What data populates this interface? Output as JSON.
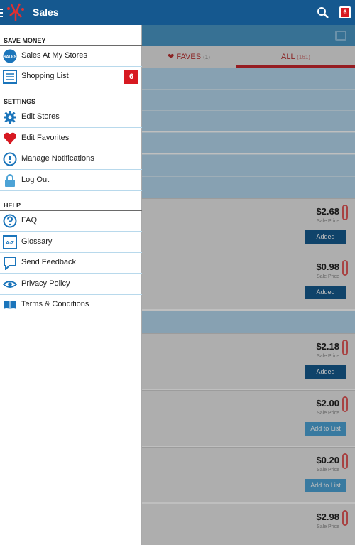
{
  "app": {
    "title": "Sales",
    "cart_count": "6"
  },
  "background": {
    "tabs": [
      {
        "label": "FAVES",
        "count": "(1)"
      },
      {
        "label": "ALL",
        "count": "(161)"
      }
    ],
    "deals": [
      {
        "price": "$2.68",
        "price_label": "Sale Price",
        "action": "Added"
      },
      {
        "price": "$0.98",
        "price_label": "Sale Price",
        "action": "Added"
      },
      {
        "price": "$2.18",
        "price_label": "Sale Price",
        "action": "Added"
      },
      {
        "price": "$2.00",
        "price_label": "Sale Price",
        "action": "Add to List"
      },
      {
        "price": "$0.20",
        "price_label": "Sale Price",
        "action": "Add to List"
      },
      {
        "price": "$2.98",
        "price_label": "Sale Price",
        "action": ""
      }
    ]
  },
  "drawer": {
    "save_money": {
      "header": "SAVE MONEY",
      "items": [
        {
          "label": "Sales At My Stores",
          "icon": "sales-icon",
          "icon_text": "SALES"
        },
        {
          "label": "Shopping List",
          "icon": "list-icon",
          "badge": "6"
        }
      ]
    },
    "settings": {
      "header": "SETTINGS",
      "items": [
        {
          "label": "Edit Stores",
          "icon": "gear-icon"
        },
        {
          "label": "Edit Favorites",
          "icon": "heart-icon"
        },
        {
          "label": "Manage Notifications",
          "icon": "alert-icon"
        },
        {
          "label": "Log Out",
          "icon": "lock-icon"
        }
      ]
    },
    "help": {
      "header": "HELP",
      "items": [
        {
          "label": "FAQ",
          "icon": "question-icon"
        },
        {
          "label": "Glossary",
          "icon": "glossary-icon",
          "icon_text": "A-Z"
        },
        {
          "label": "Send Feedback",
          "icon": "speech-bubble-icon"
        },
        {
          "label": "Privacy Policy",
          "icon": "eye-icon"
        },
        {
          "label": "Terms & Conditions",
          "icon": "book-icon"
        }
      ]
    }
  },
  "colors": {
    "appbar": "#15588f",
    "accent_red": "#d71921",
    "icon_blue": "#1b75bb"
  }
}
